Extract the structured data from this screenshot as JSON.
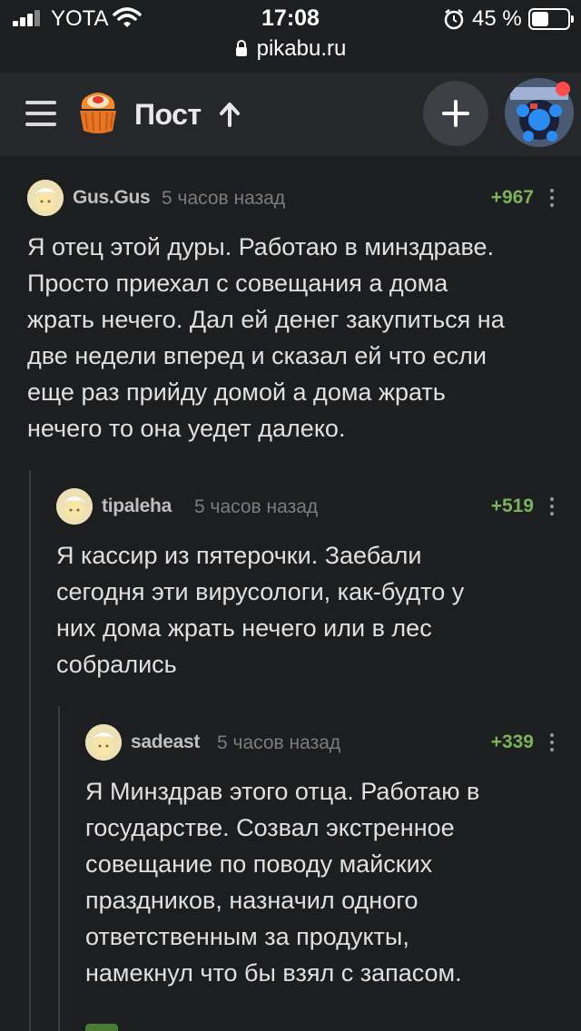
{
  "status_bar": {
    "carrier": "YOTA",
    "time": "17:08",
    "battery": "45 %",
    "url": "pikabu.ru"
  },
  "header": {
    "title": "Пост",
    "icons": [
      "menu-icon",
      "pikabu-logo",
      "arrow-up-icon",
      "plus-icon",
      "user-avatar"
    ],
    "notification": true
  },
  "comments": [
    {
      "author": "Gus.Gus",
      "time": "5 часов назад",
      "rating": "+967",
      "lines": [
        "Я отец этой дуры. Работаю в минздраве.",
        "Просто приехал с совещания а дома",
        "жрать нечего. Дал ей денег закупиться на",
        "две недели вперед и сказал ей что если",
        "еще раз прийду домой а дома жрать",
        "нечего то она уедет далеко."
      ]
    },
    {
      "author": "tipaleha",
      "time": "5 часов назад",
      "rating": "+519",
      "lines": [
        "Я кассир из пятерочки. Заебали",
        "сегодня эти вирусологи, как-будто у",
        "них дома жрать нечего или в лес",
        "собрались"
      ]
    },
    {
      "author": "sadeast",
      "time": "5 часов назад",
      "rating": "+339",
      "lines": [
        "Я Минздрав этого отца. Работаю в",
        "государстве. Созвал экстренное",
        "совещание по поводу майских",
        "праздников, назначил одного",
        "ответственным за продукты,",
        "намекнул что бы взял с запасом."
      ]
    }
  ],
  "colors": {
    "background": "#1d1e20",
    "header": "#26272a",
    "rating_positive": "#7cb25b",
    "notification": "#ff4d4d"
  }
}
